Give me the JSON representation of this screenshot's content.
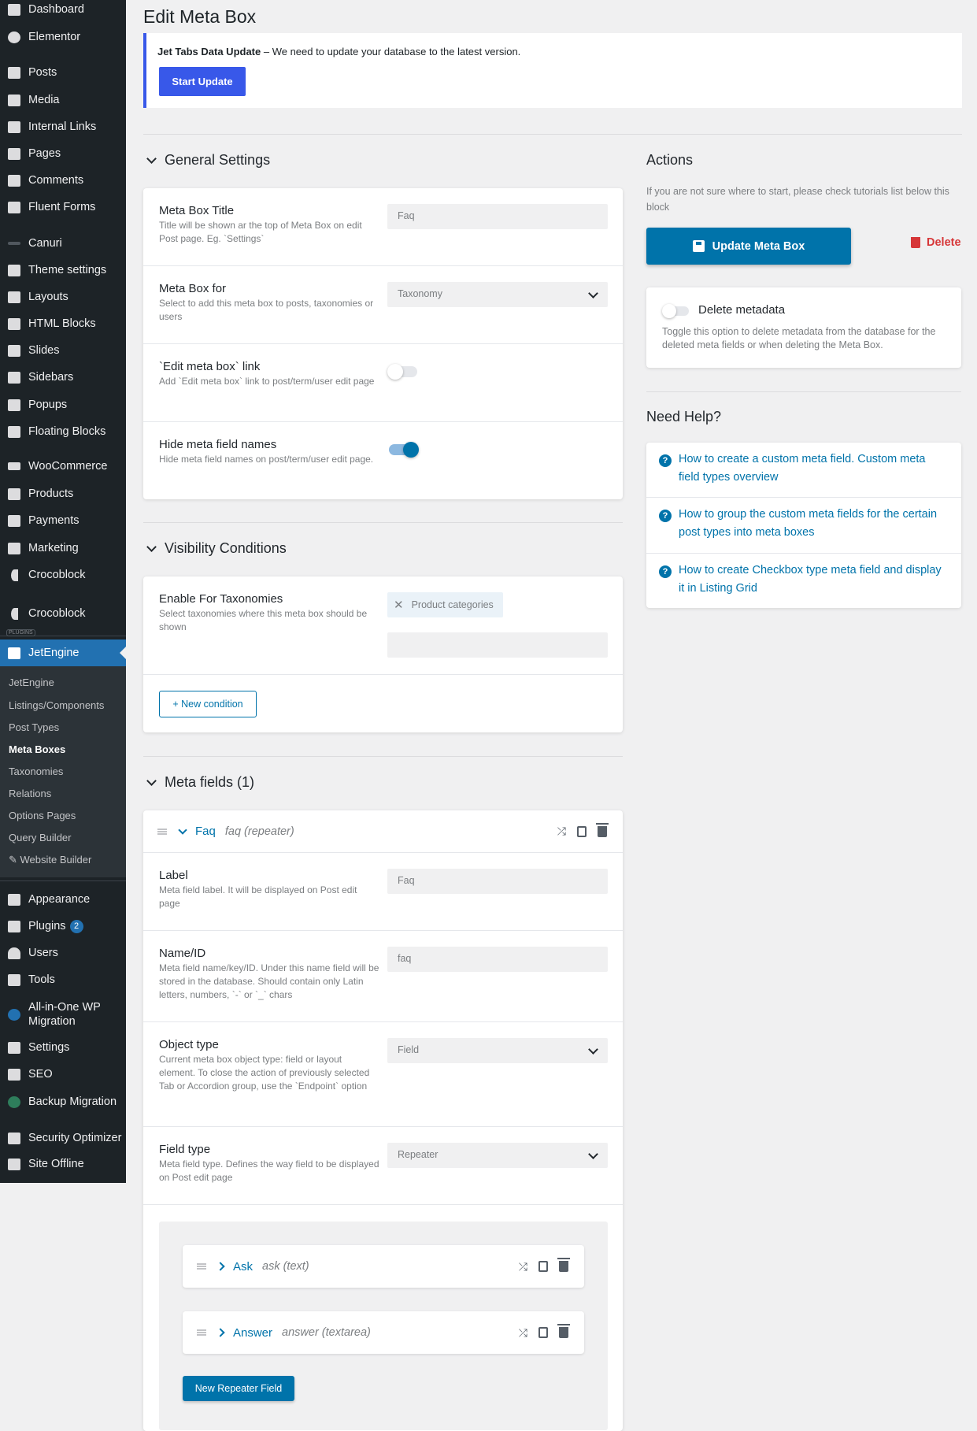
{
  "sidebar": {
    "items": [
      {
        "label": "Dashboard",
        "icon": "dashboard-icon"
      },
      {
        "label": "Elementor",
        "icon": "elementor-icon"
      },
      {
        "label": "Posts",
        "icon": "pin-icon"
      },
      {
        "label": "Media",
        "icon": "media-icon"
      },
      {
        "label": "Internal Links",
        "icon": "link-icon"
      },
      {
        "label": "Pages",
        "icon": "pages-icon"
      },
      {
        "label": "Comments",
        "icon": "comments-icon"
      },
      {
        "label": "Fluent Forms",
        "icon": "forms-icon"
      },
      {
        "label": "Canuri",
        "icon": "canuri-icon"
      },
      {
        "label": "Theme settings",
        "icon": "sliders-icon"
      },
      {
        "label": "Layouts",
        "icon": "layers-icon"
      },
      {
        "label": "HTML Blocks",
        "icon": "html-icon"
      },
      {
        "label": "Slides",
        "icon": "slides-icon"
      },
      {
        "label": "Sidebars",
        "icon": "sidebar-icon"
      },
      {
        "label": "Popups",
        "icon": "popup-icon"
      },
      {
        "label": "Floating Blocks",
        "icon": "floating-icon"
      },
      {
        "label": "WooCommerce",
        "icon": "woo-icon"
      },
      {
        "label": "Products",
        "icon": "products-icon"
      },
      {
        "label": "Payments",
        "icon": "payments-icon"
      },
      {
        "label": "Marketing",
        "icon": "megaphone-icon"
      },
      {
        "label": "Crocoblock",
        "icon": "crocoblock-icon"
      },
      {
        "label": "Crocoblock",
        "icon": "crocoblock-icon"
      },
      {
        "label": "JetEngine",
        "icon": "jetengine-icon"
      }
    ],
    "plugins_label": "PLUGINS",
    "submenu": [
      "JetEngine",
      "Listings/Components",
      "Post Types",
      "Meta Boxes",
      "Taxonomies",
      "Relations",
      "Options Pages",
      "Query Builder",
      "Website Builder"
    ],
    "bottom": [
      {
        "label": "Appearance",
        "icon": "brush-icon"
      },
      {
        "label": "Plugins",
        "icon": "plugins-icon",
        "badge": "2"
      },
      {
        "label": "Users",
        "icon": "users-icon"
      },
      {
        "label": "Tools",
        "icon": "wrench-icon"
      },
      {
        "label": "All-in-One WP",
        "label2": "Migration",
        "icon": "migration-icon"
      },
      {
        "label": "Settings",
        "icon": "settings-icon"
      },
      {
        "label": "SEO",
        "icon": "seo-icon"
      },
      {
        "label": "Backup Migration",
        "icon": "backup-icon"
      },
      {
        "label": "Security Optimizer",
        "icon": "security-icon"
      },
      {
        "label": "Site Offline",
        "icon": "offline-icon"
      }
    ]
  },
  "page": {
    "title": "Edit Meta Box"
  },
  "notice": {
    "bold": "Jet Tabs Data Update",
    "text": " – We need to update your database to the latest version.",
    "button": "Start Update"
  },
  "general": {
    "heading": "General Settings",
    "rows": [
      {
        "title": "Meta Box Title",
        "desc": "Title will be shown ar the top of Meta Box on edit Post page. Eg. `Settings`",
        "placeholder": "Faq"
      },
      {
        "title": "Meta Box for",
        "desc": "Select to add this meta box to posts, taxonomies or users",
        "value": "Taxonomy"
      },
      {
        "title": "`Edit meta box` link",
        "desc": "Add `Edit meta box` link to post/term/user edit page",
        "toggle": false
      },
      {
        "title": "Hide meta field names",
        "desc": "Hide meta field names on post/term/user edit page.",
        "toggle": true
      }
    ]
  },
  "visibility": {
    "heading": "Visibility Conditions",
    "title": "Enable For Taxonomies",
    "desc": "Select taxonomies where this meta box should be shown",
    "chip": "Product categories",
    "button": "+ New condition"
  },
  "meta_fields": {
    "heading": "Meta fields (1)",
    "field": {
      "name": "Faq",
      "sub": "faq (repeater)"
    },
    "rows": [
      {
        "title": "Label",
        "desc": "Meta field label. It will be displayed on Post edit page",
        "value": "Faq"
      },
      {
        "title": "Name/ID",
        "desc": "Meta field name/key/ID. Under this name field will be stored in the database. Should contain only Latin letters, numbers, `-` or `_` chars",
        "value": "faq"
      },
      {
        "title": "Object type",
        "desc": "Current meta box object type: field or layout element. To close the action of previously selected Tab or Accordion group, use the `Endpoint` option",
        "value": "Field"
      },
      {
        "title": "Field type",
        "desc": "Meta field type. Defines the way field to be displayed on Post edit page",
        "value": "Repeater"
      }
    ],
    "repeater": [
      {
        "name": "Ask",
        "sub": "ask (text)"
      },
      {
        "name": "Answer",
        "sub": "answer (textarea)"
      }
    ],
    "new_repeater": "New Repeater Field"
  },
  "actions": {
    "heading": "Actions",
    "hint": "If you are not sure where to start, please check tutorials list below this block",
    "update": "Update Meta Box",
    "delete": "Delete",
    "delete_meta_title": "Delete metadata",
    "delete_meta_desc": "Toggle this option to delete metadata from the database for the deleted meta fields or when deleting the Meta Box."
  },
  "help": {
    "heading": "Need Help?",
    "links": [
      "How to create a custom meta field. Custom meta field types overview",
      "How to group the custom meta fields for the certain post types into meta boxes",
      "How to create Checkbox type meta field and display it in Listing Grid"
    ]
  },
  "colors": {
    "accent": "#0073aa",
    "notice_blue": "#3858e9",
    "danger": "#d63638",
    "sidebar": "#1d2327"
  }
}
